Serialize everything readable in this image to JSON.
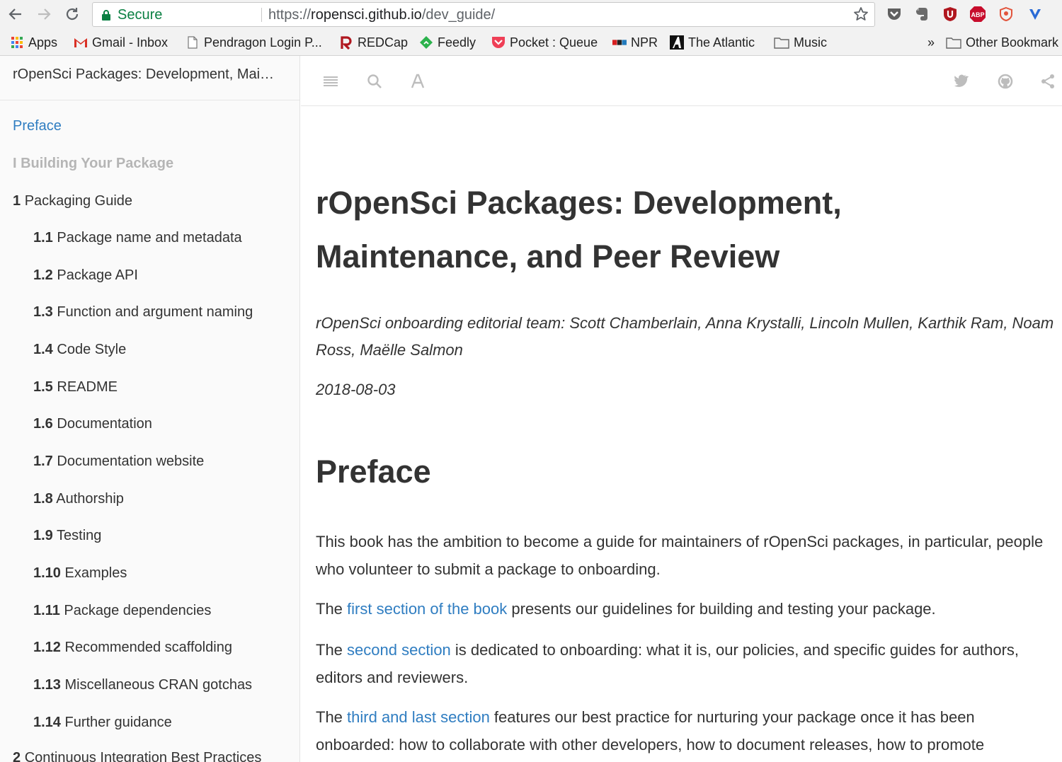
{
  "browser": {
    "secure_label": "Secure",
    "url_scheme": "https://",
    "url_host": "ropensci.github.io",
    "url_path": "/dev_guide/",
    "bookmarks": [
      {
        "label": "Apps",
        "icon": "apps-grid-icon"
      },
      {
        "label": "Gmail - Inbox",
        "icon": "gmail-icon"
      },
      {
        "label": "Pendragon Login P...",
        "icon": "page-icon"
      },
      {
        "label": "REDCap",
        "icon": "redcap-icon"
      },
      {
        "label": "Feedly",
        "icon": "feedly-icon"
      },
      {
        "label": "Pocket : Queue",
        "icon": "pocket-icon"
      },
      {
        "label": "NPR",
        "icon": "npr-icon"
      },
      {
        "label": "The Atlantic",
        "icon": "atlantic-icon"
      },
      {
        "label": "Music",
        "icon": "folder-icon"
      }
    ],
    "overflow_label": "»",
    "other_bookmarks": "Other Bookmark",
    "extensions": [
      "pocket-ext-icon",
      "evernote-ext-icon",
      "ublock-ext-icon",
      "adblock-plus-ext-icon",
      "privacy-badger-ext-icon",
      "vivaldi-ext-icon"
    ],
    "ext_abp_text": "ABP"
  },
  "sidebar": {
    "book_title": "rOpenSci Packages: Development, Mai…",
    "preface": "Preface",
    "part_label": "I Building Your Package",
    "chapter1": {
      "num": "1",
      "label": "Packaging Guide"
    },
    "items": [
      {
        "num": "1.1",
        "label": "Package name and metadata"
      },
      {
        "num": "1.2",
        "label": "Package API"
      },
      {
        "num": "1.3",
        "label": "Function and argument naming"
      },
      {
        "num": "1.4",
        "label": "Code Style"
      },
      {
        "num": "1.5",
        "label": "README"
      },
      {
        "num": "1.6",
        "label": "Documentation"
      },
      {
        "num": "1.7",
        "label": "Documentation website"
      },
      {
        "num": "1.8",
        "label": "Authorship"
      },
      {
        "num": "1.9",
        "label": "Testing"
      },
      {
        "num": "1.10",
        "label": "Examples"
      },
      {
        "num": "1.11",
        "label": "Package dependencies"
      },
      {
        "num": "1.12",
        "label": "Recommended scaffolding"
      },
      {
        "num": "1.13",
        "label": "Miscellaneous CRAN gotchas"
      },
      {
        "num": "1.14",
        "label": "Further guidance"
      }
    ],
    "chapter2": {
      "num": "2",
      "label": "Continuous Integration Best Practices"
    }
  },
  "content": {
    "title_line1": "rOpenSci Packages: Development,",
    "title_line2": "Maintenance, and Peer Review",
    "authors": "rOpenSci onboarding editorial team: Scott Chamberlain, Anna Krystalli, Lincoln Mullen, Karthik Ram, Noam Ross, Maëlle Salmon",
    "date": "2018-08-03",
    "preface_heading": "Preface",
    "p1": "This book has the ambition to become a guide for maintainers of rOpenSci packages, in particular, people who volunteer to submit a package to onboarding.",
    "p2_pre": "The ",
    "p2_link": "first section of the book",
    "p2_post": " presents our guidelines for building and testing your package.",
    "p3_pre": "The ",
    "p3_link": "second section",
    "p3_post": " is dedicated to onboarding: what it is, our policies, and specific guides for authors, editors and reviewers.",
    "p4_pre": "The ",
    "p4_link": "third and last section",
    "p4_post": " features our best practice for nurturing your package once it has been onboarded: how to collaborate with other developers, how to document releases, how to promote"
  },
  "colors": {
    "link": "#2f7dc1",
    "secure": "#0b8043",
    "part": "#b5b5b5"
  }
}
